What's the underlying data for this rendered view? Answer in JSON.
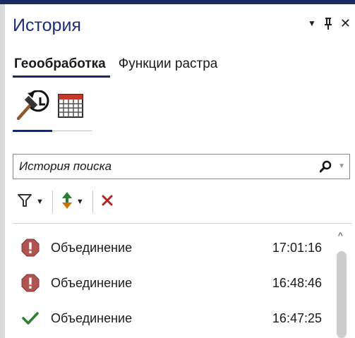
{
  "panel": {
    "title": "История",
    "header_icons": [
      "dropdown-arrow-icon",
      "pin-icon",
      "close-icon"
    ],
    "close_glyph": "✕"
  },
  "tabs": [
    {
      "label": "Геообработка",
      "active": true
    },
    {
      "label": "Функции растра",
      "active": false
    }
  ],
  "subtabs": [
    {
      "icon": "history-hammer-icon",
      "active": true
    },
    {
      "icon": "calendar-icon",
      "active": false
    }
  ],
  "search": {
    "placeholder": "История поиска",
    "value": ""
  },
  "toolbar": {
    "buttons": [
      {
        "icon": "filter-icon",
        "dropdown": true
      },
      {
        "icon": "sort-icon",
        "dropdown": true
      },
      {
        "icon": "delete-icon",
        "dropdown": false
      }
    ]
  },
  "history": [
    {
      "status": "error",
      "status_icon": "error-icon",
      "name": "Объединение",
      "time": "17:01:16"
    },
    {
      "status": "error",
      "status_icon": "error-icon",
      "name": "Объединение",
      "time": "16:48:46"
    },
    {
      "status": "success",
      "status_icon": "checkmark-icon",
      "name": "Объединение",
      "time": "16:47:25"
    }
  ],
  "colors": {
    "accent": "#1c2a63",
    "title": "#1d2f78",
    "error": "#b0544f",
    "success": "#2e7d32",
    "delete": "#b22222",
    "sort_up": "#2e7d32",
    "sort_down": "#c77700"
  }
}
